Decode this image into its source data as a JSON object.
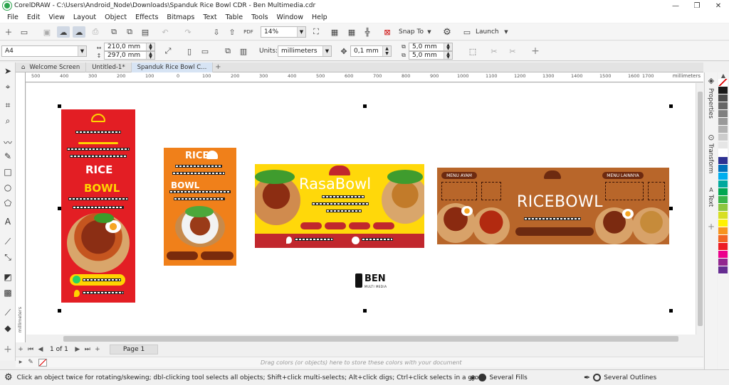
{
  "window": {
    "title": "CorelDRAW - C:\\Users\\Android_Node\\Downloads\\Spanduk Rice Bowl CDR - Ben Multimedia.cdr",
    "minimize": "—",
    "maximize": "❐",
    "close": "✕"
  },
  "menu": [
    "File",
    "Edit",
    "View",
    "Layout",
    "Object",
    "Effects",
    "Bitmaps",
    "Text",
    "Table",
    "Tools",
    "Window",
    "Help"
  ],
  "toolbar": {
    "zoom_value": "14%",
    "snap_label": "Snap To",
    "launch_label": "Launch"
  },
  "propertybar": {
    "page_size": "A4",
    "width": "210,0 mm",
    "height": "297,0 mm",
    "units_label": "Units:",
    "units_value": "millimeters",
    "nudge": "0,1 mm",
    "dup_x": "5,0 mm",
    "dup_y": "5,0 mm"
  },
  "tabs": [
    "Welcome Screen",
    "Untitled-1*",
    "Spanduk Rice Bowl C..."
  ],
  "ruler": {
    "ticks": [
      "500",
      "400",
      "300",
      "200",
      "100",
      "0",
      "100",
      "200",
      "300",
      "400",
      "500",
      "600",
      "700",
      "800",
      "900",
      "1000",
      "1100",
      "1200",
      "1300",
      "1400",
      "1500",
      "1600",
      "1700"
    ],
    "unit": "millimeters",
    "vertical_unit": "millimeters"
  },
  "pagenav": {
    "page_count": "1 of 1",
    "page_tab": "Page 1"
  },
  "colortray": {
    "hint": "Drag colors (or objects) here to store these colors with your document"
  },
  "status": {
    "hint": "Click an object twice for rotating/skewing; dbl-clicking tool selects all objects; Shift+click multi-selects; Alt+click digs; Ctrl+click selects in a group",
    "fill": "Several Fills",
    "outline": "Several Outlines"
  },
  "dockers": [
    "Properties",
    "Transform",
    "Text"
  ],
  "palette": [
    "#ffffff",
    "#1a1a1a",
    "#4d4d4d",
    "#666666",
    "#808080",
    "#999999",
    "#b3b3b3",
    "#cccccc",
    "#e6e6e6",
    "#ffffff",
    "#2e3192",
    "#0072bc",
    "#00aeef",
    "#00a99d",
    "#00a651",
    "#39b54a",
    "#8dc63f",
    "#d7df23",
    "#fff200",
    "#f7941d",
    "#f26522",
    "#ed1c24",
    "#ec008c",
    "#92278f",
    "#662d91"
  ],
  "artwork": {
    "banner1": {
      "line1": "RICE",
      "line2": "BOWL"
    },
    "banner2": {
      "line1": "RICE",
      "line2": "BOWL"
    },
    "banner3": {
      "title": "RasaBowl"
    },
    "banner4": {
      "title": "RICEBOWL",
      "tag_left": "MENU AYAM",
      "tag_right": "MENU LAINNYA"
    },
    "logo": {
      "text": "BEN",
      "sub": "MULTI MEDIA"
    }
  }
}
